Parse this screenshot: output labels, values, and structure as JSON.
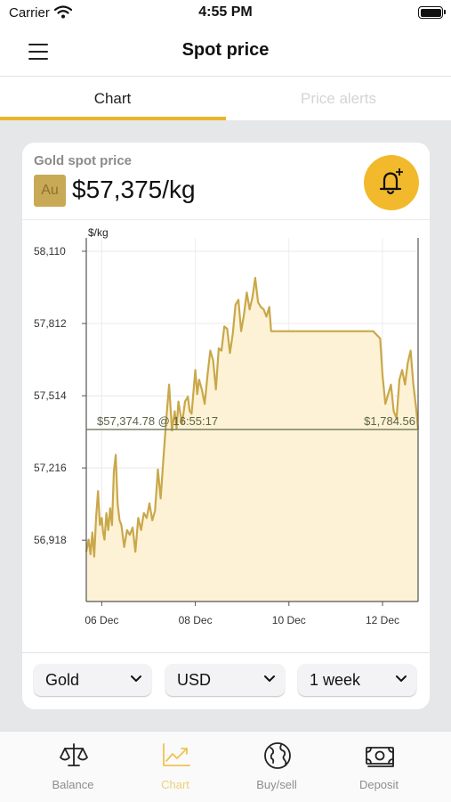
{
  "status_bar": {
    "carrier": "Carrier",
    "time": "4:55 PM"
  },
  "nav": {
    "title": "Spot price",
    "menu_icon": "hamburger-menu-icon"
  },
  "tabs": [
    {
      "label": "Chart",
      "active": true
    },
    {
      "label": "Price alerts",
      "active": false
    }
  ],
  "card": {
    "label": "Gold spot price",
    "symbol": "Au",
    "price": "$57,375/kg",
    "alert_icon": "bell-plus-icon"
  },
  "chart_data": {
    "type": "area",
    "ylabel": "$/kg",
    "y_ticks": [
      "58,110",
      "57,812",
      "57,514",
      "57,216",
      "56,918"
    ],
    "y_tick_values": [
      58110,
      57812,
      57514,
      57216,
      56918
    ],
    "ylim": [
      56665,
      58165
    ],
    "x_ticks": [
      "06 Dec",
      "08 Dec",
      "10 Dec",
      "12 Dec"
    ],
    "x_tick_values": [
      6,
      8,
      10,
      12
    ],
    "xlim": [
      5.67,
      12.76
    ],
    "grid": true,
    "current_line": {
      "value": 57374.78,
      "left_label": "$57,374.78 @ 16:55:17",
      "right_label": "$1,784.56"
    },
    "series": [
      {
        "x": [
          5.67,
          5.72,
          5.76,
          5.8,
          5.84,
          5.88,
          5.92,
          5.96,
          6.0,
          6.03,
          6.06,
          6.1,
          6.14,
          6.18,
          6.22,
          6.26,
          6.3,
          6.34,
          6.38,
          6.42,
          6.48,
          6.54,
          6.6,
          6.66,
          6.72,
          6.78,
          6.84,
          6.9,
          6.96,
          7.02,
          7.08,
          7.14,
          7.2,
          7.26,
          7.32,
          7.38,
          7.44,
          7.5,
          7.56,
          7.6,
          7.64,
          7.68,
          7.72,
          7.78,
          7.84,
          7.88,
          7.92,
          7.96,
          8.0,
          8.04,
          8.08,
          8.14,
          8.2,
          8.26,
          8.32,
          8.38,
          8.44,
          8.5,
          8.56,
          8.62,
          8.68,
          8.74,
          8.8,
          8.86,
          8.92,
          8.98,
          9.04,
          9.1,
          9.16,
          9.22,
          9.28,
          9.34,
          9.4,
          9.46,
          9.52,
          9.58,
          9.62,
          9.66,
          9.7,
          9.74,
          9.78,
          9.82,
          9.86,
          9.92,
          10.0,
          10.5,
          11.0,
          11.5,
          11.8,
          11.95,
          12.0,
          12.06,
          12.12,
          12.18,
          12.24,
          12.3,
          12.36,
          12.42,
          12.48,
          12.54,
          12.6,
          12.66,
          12.72,
          12.76
        ],
        "y": [
          56870,
          56920,
          56860,
          56950,
          56850,
          57010,
          57120,
          56980,
          57010,
          56950,
          56920,
          57030,
          56960,
          57050,
          56980,
          57200,
          57270,
          57070,
          57000,
          56980,
          56890,
          56960,
          56940,
          56970,
          56870,
          57010,
          56960,
          57030,
          57010,
          57070,
          57000,
          57040,
          57210,
          57090,
          57260,
          57420,
          57560,
          57370,
          57450,
          57380,
          57490,
          57440,
          57400,
          57490,
          57510,
          57450,
          57440,
          57530,
          57620,
          57520,
          57580,
          57540,
          57480,
          57600,
          57700,
          57660,
          57540,
          57710,
          57700,
          57800,
          57790,
          57690,
          57770,
          57890,
          57910,
          57780,
          57850,
          57940,
          57870,
          57920,
          58000,
          57900,
          57880,
          57870,
          57840,
          57880,
          57780,
          57780,
          57780,
          57780,
          57780,
          57780,
          57780,
          57780,
          57780,
          57780,
          57780,
          57780,
          57780,
          57750,
          57600,
          57480,
          57520,
          57560,
          57450,
          57420,
          57580,
          57620,
          57560,
          57650,
          57700,
          57560,
          57460,
          57375
        ]
      }
    ]
  },
  "selectors": [
    {
      "label": "Gold"
    },
    {
      "label": "USD"
    },
    {
      "label": "1 week"
    }
  ],
  "tabbar": [
    {
      "label": "Balance",
      "icon": "scales-icon",
      "active": false
    },
    {
      "label": "Chart",
      "icon": "line-chart-icon",
      "active": true
    },
    {
      "label": "Buy/sell",
      "icon": "globe-icon",
      "active": false
    },
    {
      "label": "Deposit",
      "icon": "banknote-icon",
      "active": false
    }
  ],
  "colors": {
    "accent": "#f2b92c",
    "tab_underline": "#e9b52a",
    "line": "#c9a84a",
    "area_fill": "#fdf2d5",
    "current_line": "#6e7658",
    "inactive_text": "#d4d4d4"
  }
}
